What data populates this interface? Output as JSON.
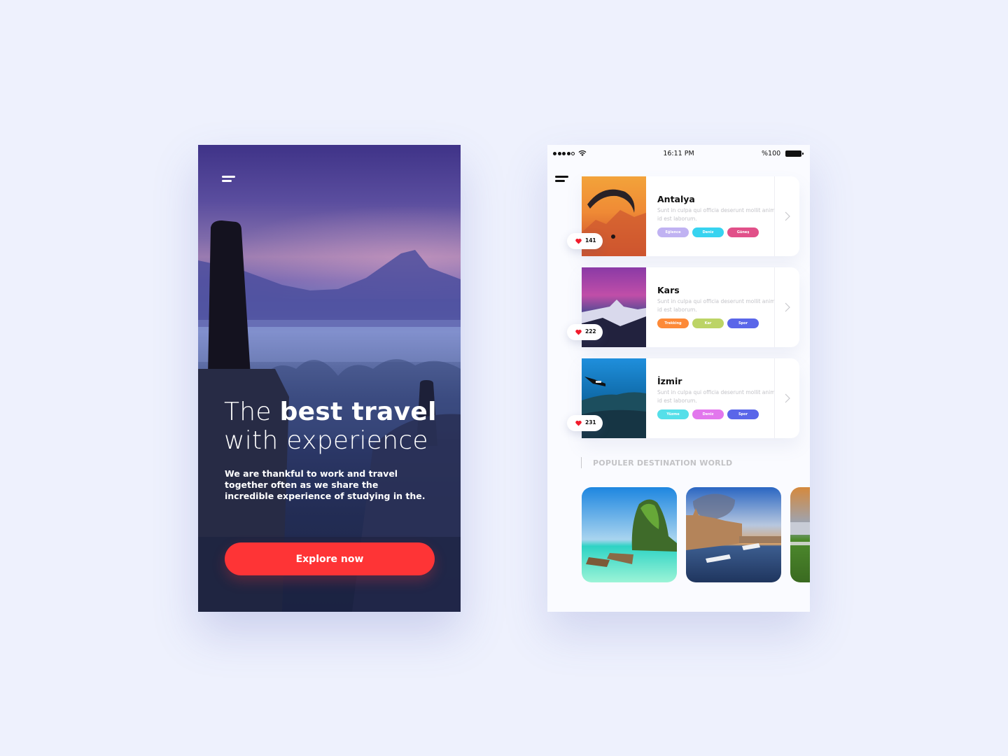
{
  "onboarding": {
    "menu_icon": "hamburger-menu-icon",
    "headline_light_1": "The ",
    "headline_bold": "best travel",
    "headline_light_2": "with experience",
    "description": "We are thankful to work and travel together often as we share the incredible experience of studying in the.",
    "cta_label": "Explore now",
    "cta_color": "#fe3436"
  },
  "status_bar": {
    "signal_icon": "signal-dots-icon",
    "wifi_icon": "wifi-icon",
    "time": "16:11 PM",
    "battery_percent": "%100",
    "battery_icon": "battery-icon"
  },
  "list_screen": {
    "menu_icon": "hamburger-menu-icon",
    "destinations": [
      {
        "name": "Antalya",
        "description": "Sunt in culpa qui officia deserunt mollit anim id est laborum.",
        "likes": "141",
        "tags": [
          {
            "label": "Eğlence",
            "color": "#c0b2f2"
          },
          {
            "label": "Deniz",
            "color": "#37d3f0"
          },
          {
            "label": "Güneş",
            "color": "#e15089"
          }
        ]
      },
      {
        "name": "Kars",
        "description": "Sunt in culpa qui officia deserunt mollit anim id est laborum.",
        "likes": "222",
        "tags": [
          {
            "label": "Trekking",
            "color": "#fd8a38"
          },
          {
            "label": "Kar",
            "color": "#bcd466"
          },
          {
            "label": "Spor",
            "color": "#5a66e9"
          }
        ]
      },
      {
        "name": "İzmir",
        "description": "Sunt in culpa qui officia deserunt mollit anim id est laborum.",
        "likes": "231",
        "tags": [
          {
            "label": "Yüzme",
            "color": "#55dfe9"
          },
          {
            "label": "Deniz",
            "color": "#e277ed"
          },
          {
            "label": "Spor",
            "color": "#5a66e9"
          }
        ]
      }
    ],
    "section_title": "POPULER DESTINATION WORLD",
    "popular": [
      {
        "label": "tropical-island-boats"
      },
      {
        "label": "river-city-cruise"
      },
      {
        "label": "palace-garden"
      }
    ]
  },
  "colors": {
    "page_background": "#eef1fd",
    "heart": "#f21b2b"
  }
}
